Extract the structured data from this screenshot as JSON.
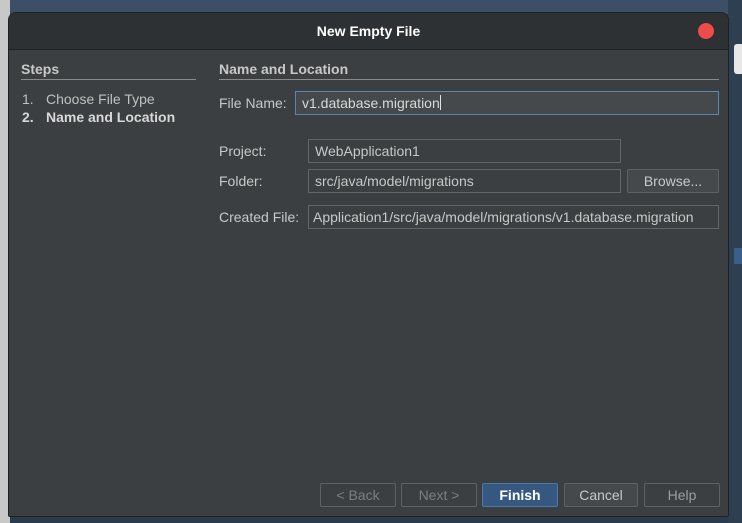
{
  "dialog": {
    "title": "New Empty File"
  },
  "steps": {
    "heading": "Steps",
    "items": [
      {
        "num": "1.",
        "label": "Choose File Type"
      },
      {
        "num": "2.",
        "label": "Name and Location"
      }
    ]
  },
  "form": {
    "heading": "Name and Location",
    "file_name_label": "File Name:",
    "file_name_value": "v1.database.migration",
    "project_label": "Project:",
    "project_value": "WebApplication1",
    "folder_label": "Folder:",
    "folder_value": "src/java/model/migrations",
    "browse_label": "Browse...",
    "created_file_label": "Created File:",
    "created_file_value": "Application1/src/java/model/migrations/v1.database.migration"
  },
  "buttons": {
    "back": "< Back",
    "next": "Next >",
    "finish": "Finish",
    "cancel": "Cancel",
    "help": "Help"
  },
  "colors": {
    "dialog_bg": "#3b3f41",
    "primary_button": "#365880",
    "close_button": "#ee4b4b"
  }
}
